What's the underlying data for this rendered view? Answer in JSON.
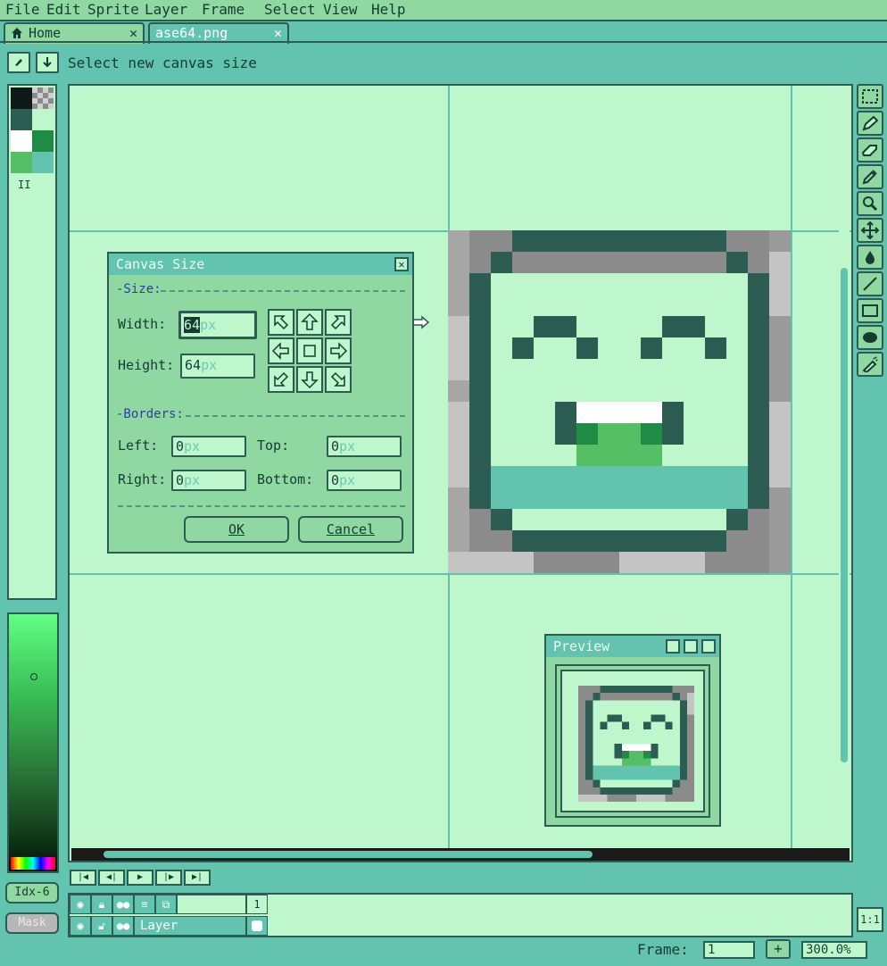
{
  "menu": [
    "File",
    "Edit",
    "Sprite",
    "Layer",
    "Frame",
    "Select",
    "View",
    "Help"
  ],
  "tabs": [
    {
      "label": "Home",
      "icon": "home-icon",
      "close": "✕"
    },
    {
      "label": "ase64.png",
      "close": "✕"
    }
  ],
  "status": {
    "text": "Select new canvas size"
  },
  "palette": {
    "colors": [
      "#0f1a17",
      "#8b8b8b",
      "#2d5d52",
      "#bff7cd",
      "#ffffff",
      "#1f8c46",
      "#56be64",
      "#62c3ae"
    ],
    "index_label": "II"
  },
  "left_buttons": {
    "index": "Idx-6",
    "mask": "Mask"
  },
  "dialog": {
    "title": "Canvas Size",
    "close": "✕",
    "size_section": "-Size:",
    "width_label": "Width:",
    "width_value": "64",
    "height_label": "Height:",
    "height_value": "64",
    "unit": "px",
    "borders_section": "-Borders:",
    "left_label": "Left:",
    "left_value": "0",
    "top_label": "Top:",
    "top_value": "0",
    "right_label": "Right:",
    "right_value": "0",
    "bottom_label": "Bottom:",
    "bottom_value": "0",
    "ok": "OK",
    "cancel": "Cancel",
    "anchors": [
      "north-west-arrow-icon",
      "north-arrow-icon",
      "north-east-arrow-icon",
      "west-arrow-icon",
      "center-square-icon",
      "east-arrow-icon",
      "south-west-arrow-icon",
      "south-arrow-icon",
      "south-east-arrow-icon"
    ]
  },
  "preview": {
    "title": "Preview"
  },
  "tools": [
    "marquee-icon",
    "pencil-icon",
    "eraser-icon",
    "eyedropper-icon",
    "zoom-icon",
    "move-icon",
    "paint-bucket-icon",
    "line-icon",
    "rectangle-icon",
    "ellipse-icon",
    "spray-icon"
  ],
  "timeline": {
    "frame_number": "1",
    "layer_name": "Layer",
    "ratio_button": "1:1"
  },
  "footer": {
    "frame_label": "Frame:",
    "frame_value": "1",
    "plus": "+",
    "zoom": "300.0%"
  }
}
